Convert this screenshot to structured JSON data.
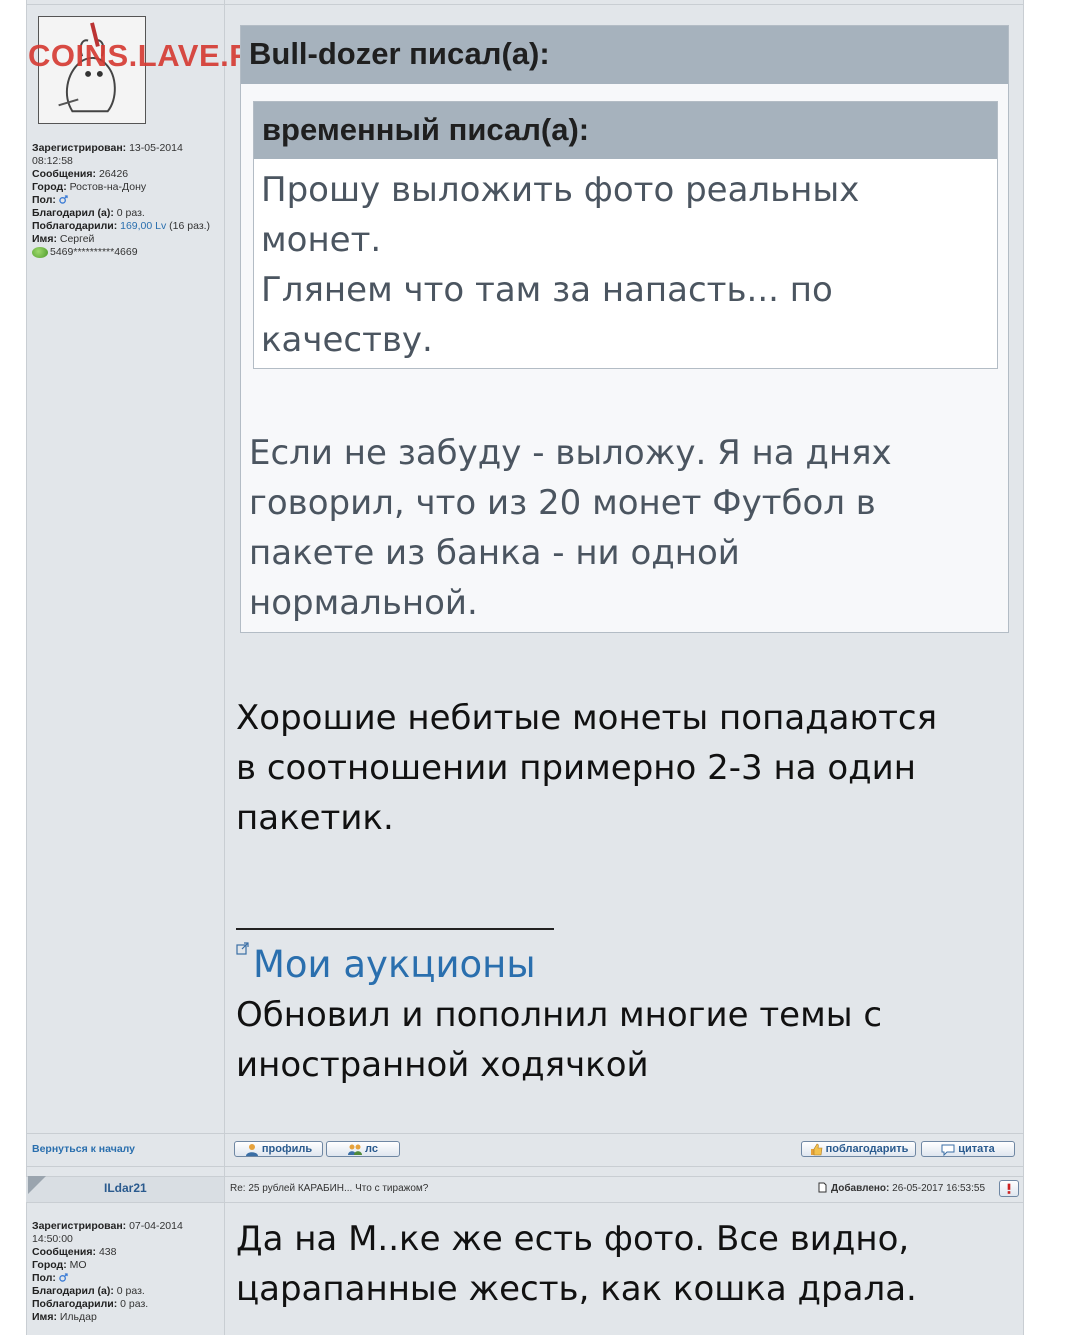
{
  "watermark": "COINS.LAVE.RU",
  "post1": {
    "author_info": {
      "registered_label": "Зарегистрирован:",
      "registered_date": "13-05-2014",
      "registered_time": "08:12:58",
      "messages_label": "Сообщения:",
      "messages": "26426",
      "city_label": "Город:",
      "city": "Ростов-на-Дону",
      "gender_label": "Пол:",
      "thanked_label": "Благодарил (а):",
      "thanked": "0 раз.",
      "was_thanked_label": "Поблагодарили:",
      "was_thanked_amount": "169,00 Lv",
      "was_thanked_times": "(16 раз.)",
      "name_label": "Имя:",
      "name": "Сергей",
      "card": "5469**********4669"
    },
    "quote_outer_header": "Bull-dozer писал(а):",
    "quote_inner_header": "временный писал(а):",
    "quote_inner_text": [
      "Прошу выложить фото реальных",
      "монет.",
      "Глянем что там за напасть... по",
      "качеству."
    ],
    "quote_outer_text": [
      "Если не забуду - выложу. Я на днях",
      "говорил, что из 20 монет Футбол в",
      "пакете из банка - ни одной",
      "нормальной."
    ],
    "body_text": [
      "Хорошие небитые монеты попадаются",
      "в соотношении примерно 2-3 на один",
      "пакетик."
    ],
    "signature_link": "Мои аукционы",
    "signature_text": [
      "Обновил и пополнил многие темы с",
      "иностранной ходячкой"
    ]
  },
  "toolbar": {
    "back_to_top": "Вернуться к началу",
    "profile": "профиль",
    "pm": "лс",
    "thank": "поблагодарить",
    "quote": "цитата"
  },
  "post2": {
    "username": "ILdar21",
    "subject": "Re: 25 рублей КАРАБИН... Что с тиражом?",
    "added_label": "Добавлено:",
    "added_date": "26-05-2017 16:53:55",
    "author_info": {
      "registered_label": "Зарегистрирован:",
      "registered_date": "07-04-2014",
      "registered_time": "14:50:00",
      "messages_label": "Сообщения:",
      "messages": "438",
      "city_label": "Город:",
      "city": "МО",
      "gender_label": "Пол:",
      "thanked_label": "Благодарил (а):",
      "thanked": "0 раз.",
      "was_thanked_label": "Поблагодарили:",
      "was_thanked": "0 раз.",
      "name_label": "Имя:",
      "name": "Ильдар"
    },
    "body_text": [
      "Да на М..ке же есть фото. Все видно,",
      "царапанные жесть, как кошка драла."
    ]
  },
  "colors": {
    "background": "#e2e6ea",
    "quote_header": "#a6b2bd",
    "link": "#2a6fae",
    "watermark": "#d63c34"
  }
}
